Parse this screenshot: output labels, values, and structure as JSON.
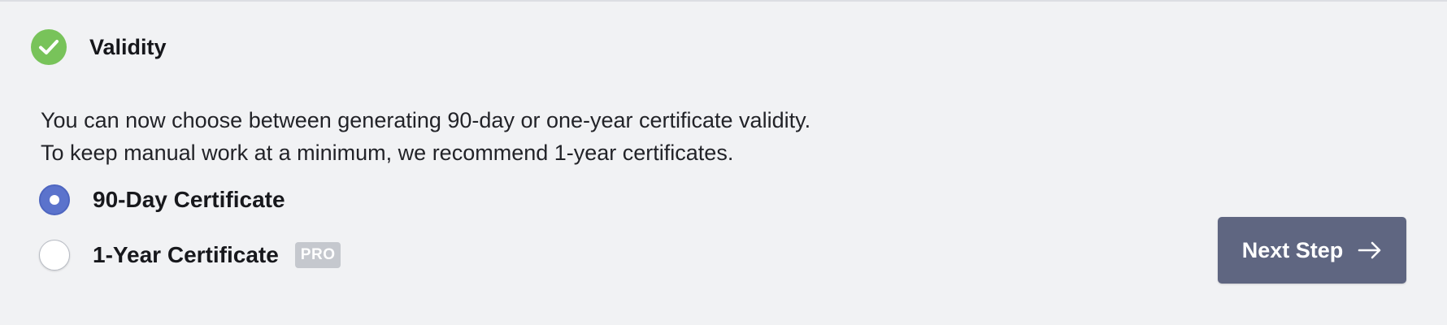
{
  "section": {
    "title": "Validity",
    "status_icon": "check-circle-icon",
    "status_color": "#78c35a"
  },
  "description": {
    "line1": "You can now choose between generating 90-day or one-year certificate validity.",
    "line2": "To keep manual work at a minimum, we recommend 1-year certificates."
  },
  "options": [
    {
      "label": "90-Day Certificate",
      "selected": true
    },
    {
      "label": "1-Year Certificate",
      "selected": false,
      "badge": "PRO"
    }
  ],
  "next_button": {
    "label": "Next Step",
    "icon": "arrow-right-icon",
    "color": "#5f6681"
  },
  "colors": {
    "accent": "#5b73cc",
    "background": "#f1f2f4",
    "badge": "#c5c8ce"
  }
}
